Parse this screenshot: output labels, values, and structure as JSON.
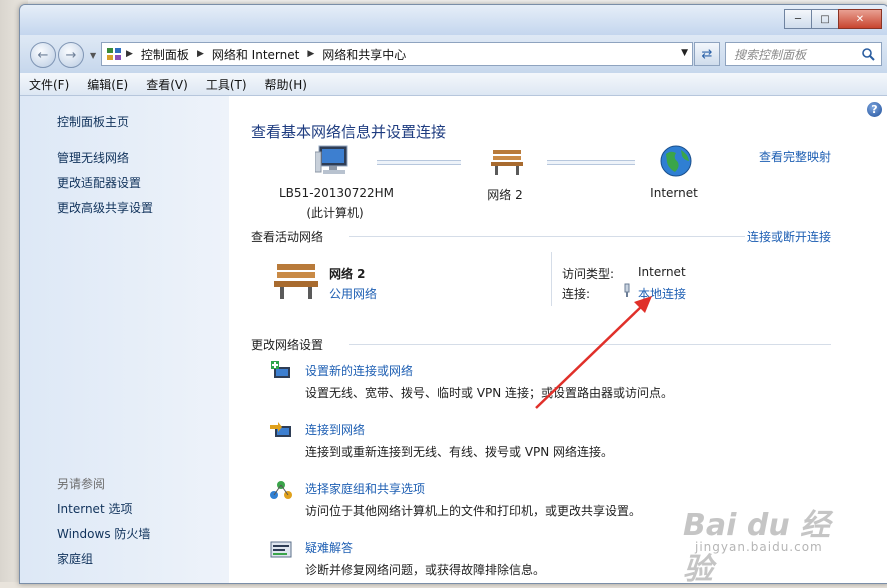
{
  "window": {
    "breadcrumb": [
      "控制面板",
      "网络和 Internet",
      "网络和共享中心"
    ],
    "search_placeholder": "搜索控制面板"
  },
  "menu": [
    "文件(F)",
    "编辑(E)",
    "查看(V)",
    "工具(T)",
    "帮助(H)"
  ],
  "sidebar": {
    "items": [
      "控制面板主页",
      "管理无线网络",
      "更改适配器设置",
      "更改高级共享设置"
    ],
    "see_also_title": "另请参阅",
    "see_also": [
      "Internet 选项",
      "Windows 防火墙",
      "家庭组"
    ]
  },
  "main": {
    "title": "查看基本网络信息并设置连接",
    "full_map": "查看完整映射",
    "map": {
      "computer_name": "LB51-20130722HM",
      "computer_sub": "(此计算机)",
      "network": "网络  2",
      "internet": "Internet"
    },
    "active_title": "查看活动网络",
    "connect_disconnect": "连接或断开连接",
    "active": {
      "name": "网络  2",
      "type_link": "公用网络",
      "access_label": "访问类型:",
      "access_value": "Internet",
      "conn_label": "连接:",
      "conn_value": "本地连接"
    },
    "change_title": "更改网络设置",
    "tasks": [
      {
        "title": "设置新的连接或网络",
        "desc": "设置无线、宽带、拨号、临时或 VPN 连接；或设置路由器或访问点。"
      },
      {
        "title": "连接到网络",
        "desc": "连接到或重新连接到无线、有线、拨号或 VPN 网络连接。"
      },
      {
        "title": "选择家庭组和共享选项",
        "desc": "访问位于其他网络计算机上的文件和打印机，或更改共享设置。"
      },
      {
        "title": "疑难解答",
        "desc": "诊断并修复网络问题，或获得故障排除信息。"
      }
    ]
  },
  "watermark": {
    "text": "Bai du 经验",
    "url": "jingyan.baidu.com"
  },
  "colors": {
    "link": "#1e5fb3",
    "title": "#1e3c80",
    "arrow": "#e0302a"
  }
}
